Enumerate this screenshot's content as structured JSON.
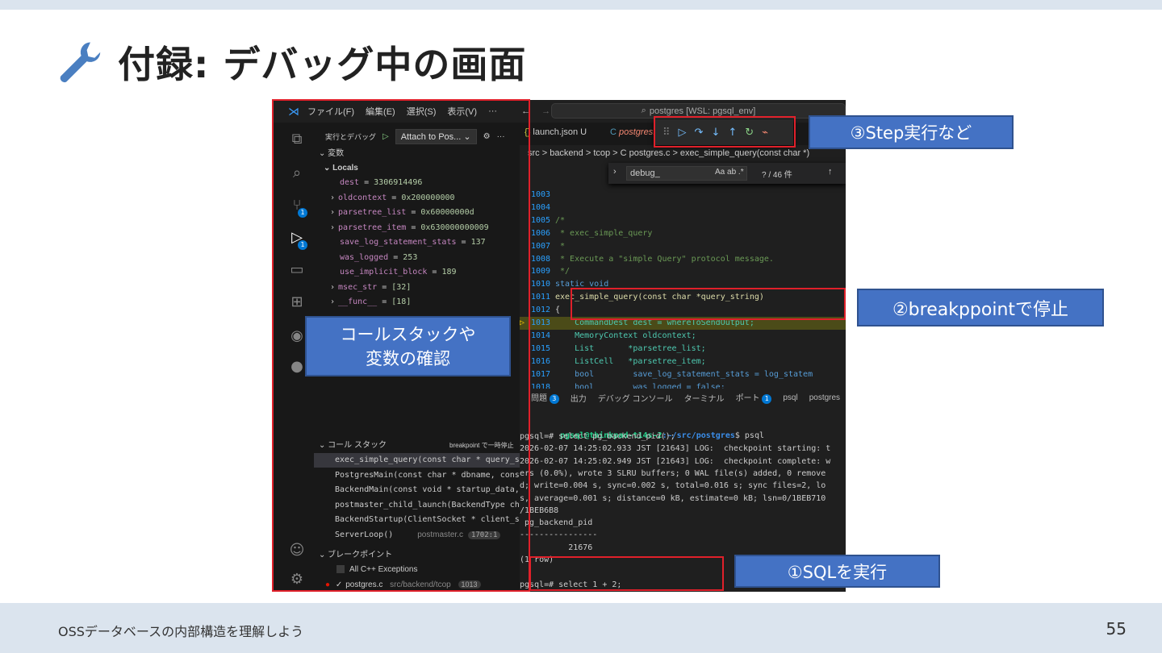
{
  "slide": {
    "title": "付録: デバッグ中の画面",
    "footer": "OSSデータベースの内部構造を理解しよう",
    "page": "55"
  },
  "vscode": {
    "menu": [
      "ファイル(F)",
      "編集(E)",
      "選択(S)",
      "表示(V)",
      "···"
    ],
    "command_center": "postgres [WSL: pgsql_env]",
    "run_debug_label": "実行とデバッグ",
    "launch_config": "Attach to Pos...",
    "variables_section": "変数",
    "locals_label": "Locals",
    "variables": [
      {
        "name": "dest",
        "value": "3306914496",
        "expandable": false
      },
      {
        "name": "oldcontext",
        "value": "0x200000000",
        "expandable": true
      },
      {
        "name": "parsetree_list",
        "value": "0x60000000d",
        "expandable": true
      },
      {
        "name": "parsetree_item",
        "value": "0x630000000009",
        "expandable": true
      },
      {
        "name": "save_log_statement_stats",
        "value": "137",
        "expandable": false
      },
      {
        "name": "was_logged",
        "value": "253",
        "expandable": false
      },
      {
        "name": "use_implicit_block",
        "value": "189",
        "expandable": false
      },
      {
        "name": "msec_str",
        "value": "[32]",
        "expandable": true
      },
      {
        "name": "__func__",
        "value": "[18]",
        "expandable": true
      }
    ],
    "callstack_section": "コール スタック",
    "callstack_status": "breakpoint で一時停止",
    "callstack": [
      {
        "frame": "exec_simple_query(const char * query_s",
        "file": "",
        "line": ""
      },
      {
        "frame": "PostgresMain(const char * dbname, cons",
        "file": "",
        "line": ""
      },
      {
        "frame": "BackendMain(const void * startup_data,",
        "file": "",
        "line": ""
      },
      {
        "frame": "postmaster_child_launch(BackendType ch",
        "file": "",
        "line": ""
      },
      {
        "frame": "BackendStartup(ClientSocket * client_s",
        "file": "",
        "line": ""
      },
      {
        "frame": "ServerLoop()",
        "file": "postmaster.c",
        "line": "1702:1"
      }
    ],
    "breakpoints_section": "ブレークポイント",
    "breakpoints": [
      {
        "label": "All C++ Exceptions",
        "file": "",
        "line": ""
      },
      {
        "label": "postgres.c",
        "file": "src/backend/tcop",
        "line": "1013"
      }
    ],
    "activity_badges": {
      "scm": "1",
      "debug": "1"
    },
    "tabs": [
      "launch.json U",
      "postgres.c"
    ],
    "breadcrumb": "src > backend > tcop > C postgres.c > exec_simple_query(const char *)",
    "find": {
      "query": "debug_",
      "options": "Aa ab .*",
      "count": "? / 46 件"
    },
    "code": [
      {
        "ln": "1003",
        "text": ""
      },
      {
        "ln": "1004",
        "text": ""
      },
      {
        "ln": "1005",
        "text": "/*"
      },
      {
        "ln": "1006",
        "text": " * exec_simple_query"
      },
      {
        "ln": "1007",
        "text": " *"
      },
      {
        "ln": "1008",
        "text": " * Execute a \"simple Query\" protocol message."
      },
      {
        "ln": "1009",
        "text": " */"
      },
      {
        "ln": "1010",
        "text": "static void"
      },
      {
        "ln": "1011",
        "text": "exec_simple_query(const char *query_string)"
      },
      {
        "ln": "1012",
        "text": "{"
      },
      {
        "ln": "1013",
        "text": "    CommandDest dest = whereToSendOutput;"
      },
      {
        "ln": "1014",
        "text": "    MemoryContext oldcontext;"
      },
      {
        "ln": "1015",
        "text": "    List       *parsetree_list;"
      },
      {
        "ln": "1016",
        "text": "    ListCell   *parsetree_item;"
      },
      {
        "ln": "1017",
        "text": "    bool        save_log_statement_stats = log_statem"
      },
      {
        "ln": "1018",
        "text": "    bool        was_logged = false;"
      },
      {
        "ln": "1019",
        "text": "    bool        use_implicit_block;"
      }
    ],
    "panel_tabs": [
      "問題",
      "出力",
      "デバッグ コンソール",
      "ターミナル",
      "ポート",
      "psql",
      "postgres",
      "+"
    ],
    "panel_badges": {
      "problems": "3",
      "ports": "1"
    },
    "terminal": {
      "prompt_user": "pgsql@thinkpad-t14s-2",
      "prompt_path": ":~/src/postgres",
      "prompt_cmd": "$ psql",
      "lines": [
        "pgsql=# select pg_backend_pid();",
        "2026-02-07 14:25:02.933 JST [21643] LOG:  checkpoint starting: t",
        "2026-02-07 14:25:02.949 JST [21643] LOG:  checkpoint complete: w",
        "ers (0.0%), wrote 3 SLRU buffers; 0 WAL file(s) added, 0 remove",
        "d; write=0.004 s, sync=0.002 s, total=0.016 s; sync files=2, lo",
        "s, average=0.001 s; distance=0 kB, estimate=0 kB; lsn=0/1BEB710",
        "/1BEB6B8",
        " pg_backend_pid",
        "----------------",
        "          21676",
        "(1 row)",
        "",
        "pgsql=# select 1 + 2;"
      ]
    }
  },
  "callouts": {
    "step": "③Step実行など",
    "breakpoint": "②breakppointで停止",
    "callstack": "コールスタックや\n変数の確認",
    "sql": "①SQLを実行"
  },
  "colors": {
    "accent": "#4472c4",
    "highlight_box": "#e0202a",
    "wrench": "#4a7fc1"
  }
}
